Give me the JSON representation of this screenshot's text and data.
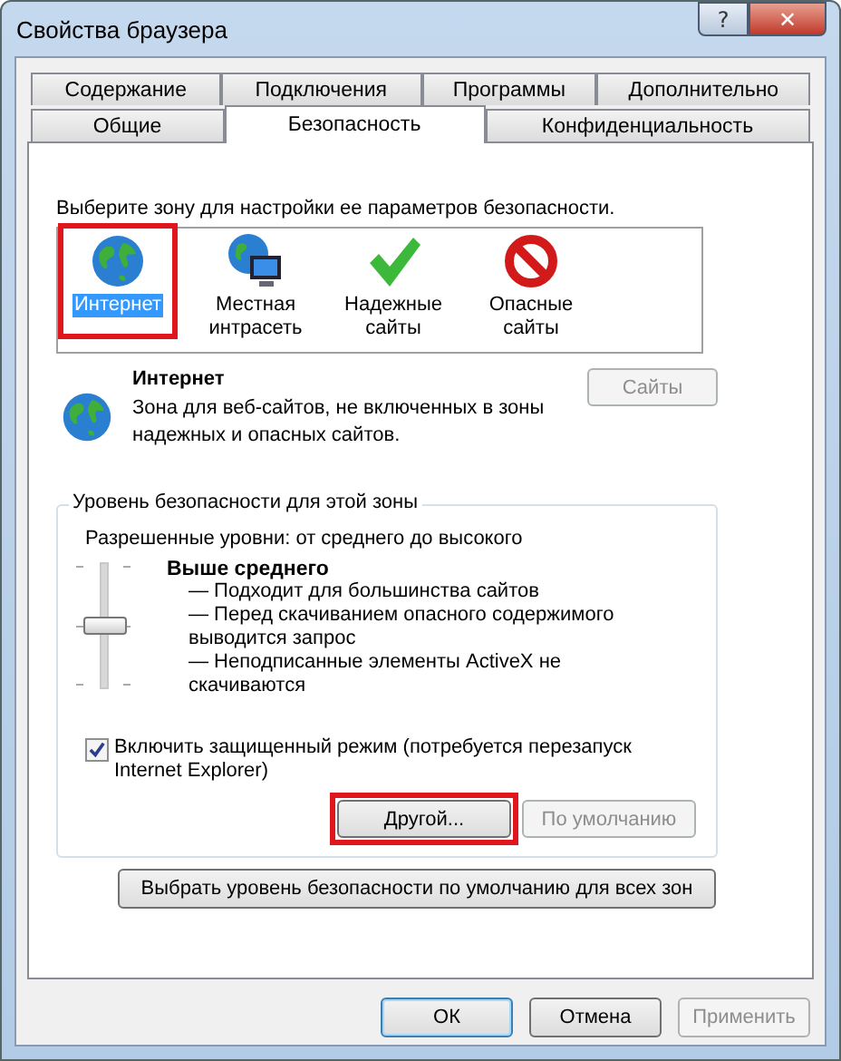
{
  "window": {
    "title": "Свойства браузера",
    "help_button": "?",
    "close_button": "✕"
  },
  "tab_rows": [
    {
      "tabs": [
        {
          "label": "Содержание",
          "selected": false
        },
        {
          "label": "Подключения",
          "selected": false
        },
        {
          "label": "Программы",
          "selected": false
        },
        {
          "label": "Дополнительно",
          "selected": false
        }
      ]
    },
    {
      "tabs": [
        {
          "label": "Общие",
          "selected": false
        },
        {
          "label": "Безопасность",
          "selected": true
        },
        {
          "label": "Конфиденциальность",
          "selected": false
        }
      ]
    }
  ],
  "zone_prompt": "Выберите зону для настройки ее параметров безопасности.",
  "zones": [
    {
      "kind": "internet",
      "label": "Интернет",
      "selected": true,
      "highlighted": true
    },
    {
      "kind": "intranet",
      "label": "Местная интрасеть",
      "selected": false,
      "highlighted": false
    },
    {
      "kind": "trusted",
      "label": "Надежные сайты",
      "selected": false,
      "highlighted": false
    },
    {
      "kind": "restricted",
      "label": "Опасные сайты",
      "selected": false,
      "highlighted": false
    }
  ],
  "zone_info": {
    "kind": "internet",
    "title": "Интернет",
    "description": "Зона для веб-сайтов, не включенных в зоны надежных и опасных сайтов.",
    "button": {
      "label": "Сайты",
      "disabled": true
    }
  },
  "security_level": {
    "legend": "Уровень безопасности для этой зоны",
    "allowed": "Разрешенные уровни: от среднего до высокого",
    "level": 0.5,
    "name": "Выше среднего",
    "points": [
      "— Подходит для большинства сайтов",
      "— Перед скачиванием опасного содержимого выводится запрос",
      "— Неподписанные элементы ActiveX не скачиваются"
    ],
    "protected_mode": {
      "label": "Включить защищенный режим (потребуется перезапуск Internet Explorer)",
      "checked": true
    },
    "buttons": [
      {
        "label": "Другой...",
        "disabled": false,
        "highlighted": true
      },
      {
        "label": "По умолчанию",
        "disabled": true,
        "highlighted": false
      }
    ]
  },
  "reset_all_button": {
    "label": "Выбрать уровень безопасности по умолчанию для всех зон",
    "disabled": false
  },
  "dialog_buttons": [
    {
      "label": "ОК",
      "disabled": false,
      "default": true
    },
    {
      "label": "Отмена",
      "disabled": false,
      "default": false
    },
    {
      "label": "Применить",
      "disabled": true,
      "default": false
    }
  ]
}
